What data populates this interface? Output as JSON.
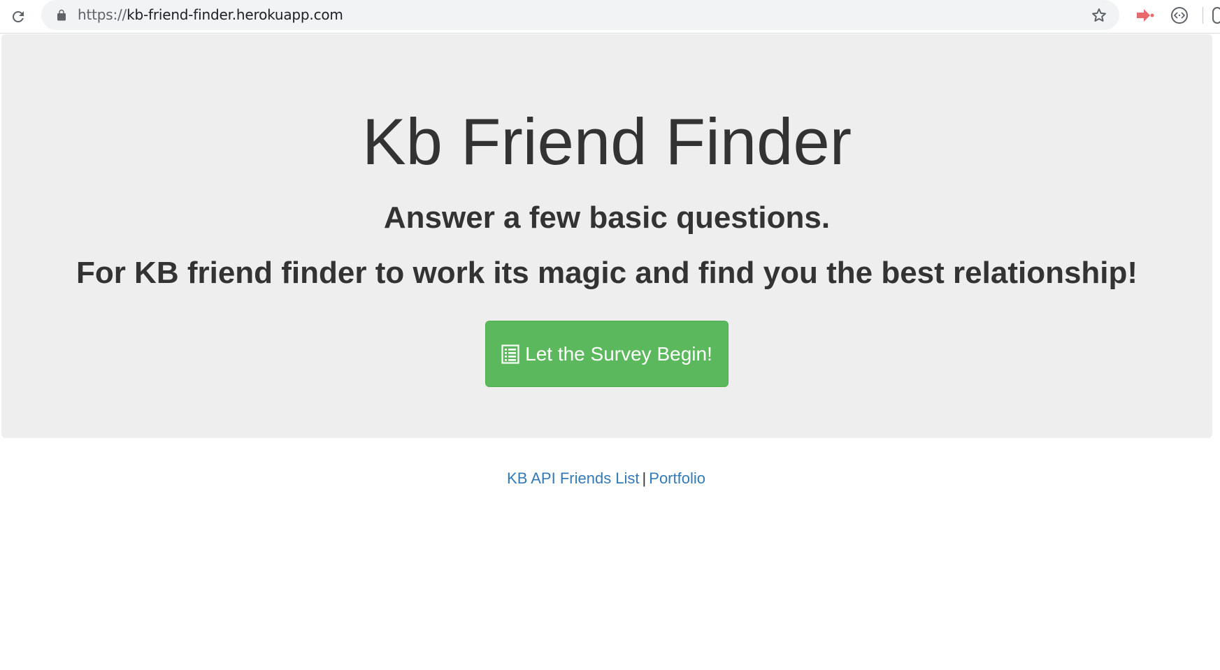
{
  "browser": {
    "url_scheme": "https://",
    "url_host": "kb-friend-finder.herokuapp.com",
    "icons": {
      "reload": "reload-icon",
      "lock": "lock-icon",
      "bookmark": "star-icon",
      "extension_1": "extension-arrow-icon",
      "extension_2": "extension-code-icon"
    },
    "colors": {
      "extension_1": "#e8696b"
    }
  },
  "jumbotron": {
    "title": "Kb Friend Finder",
    "subtitle": "Answer a few basic questions.",
    "tagline": "For KB friend finder to work its magic and find you the best relationship!",
    "survey_button": {
      "label": "Let the Survey Begin!",
      "icon": "list-alt-icon",
      "color": "#5cb85c"
    },
    "background": "#eeeeee"
  },
  "footer": {
    "api_link": "KB API Friends List",
    "separator": "|",
    "portfolio_link": "Portfolio",
    "link_color": "#337ab7"
  }
}
